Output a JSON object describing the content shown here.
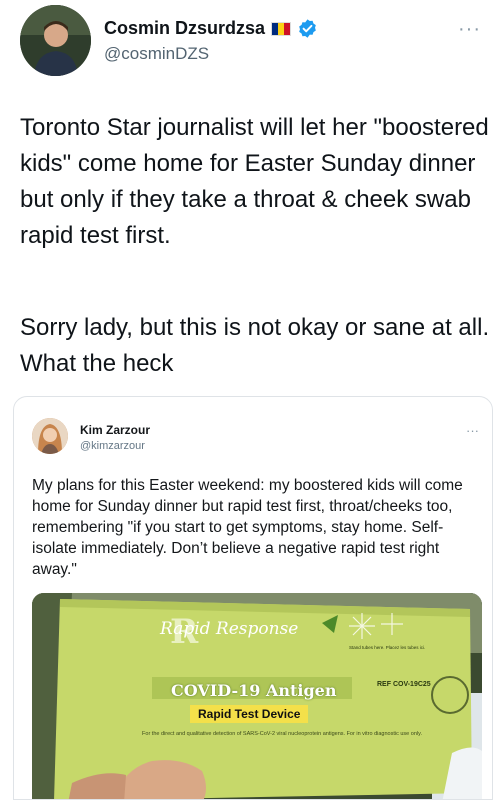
{
  "tweet": {
    "author": {
      "display_name": "Cosmin Dzsurdzsa",
      "handle": "@cosminDZS",
      "flag_colors": [
        "#002b7f",
        "#fcd116",
        "#ce1126"
      ],
      "verified": true
    },
    "more_label": "···",
    "text_paragraphs": [
      "Toronto Star journalist will let her \"boostered kids\" come home for Easter Sunday dinner but only if they take a throat & cheek swab rapid test first.",
      "Sorry lady, but this is not okay or sane at all. What the heck"
    ]
  },
  "quoted_tweet": {
    "author": {
      "display_name": "Kim Zarzour",
      "handle": "@kimzarzour"
    },
    "more_label": "···",
    "text": "My plans for this Easter weekend: my boostered kids will come home for Sunday dinner but rapid test first, throat/cheeks too, remembering \"if you start to get symptoms, stay home. Self-isolate immediately. Don’t believe a negative rapid test right away.\"",
    "image": {
      "brand": "Rapid Response",
      "title": "COVID-19 Antigen",
      "subtitle": "Rapid Test Device",
      "small_print": "For the direct and qualitative detection of SARS-CoV-2 viral nucleoprotein antigens. For in vitro diagnostic use only.",
      "ref_code": "REF COV-19C25",
      "tubes_note": "Stand tubes here. Placez les tubes ici."
    }
  },
  "colors": {
    "verified_blue": "#1d9bf0",
    "box_green": "#c6d86a",
    "subtitle_yellow": "#f4e04a"
  }
}
